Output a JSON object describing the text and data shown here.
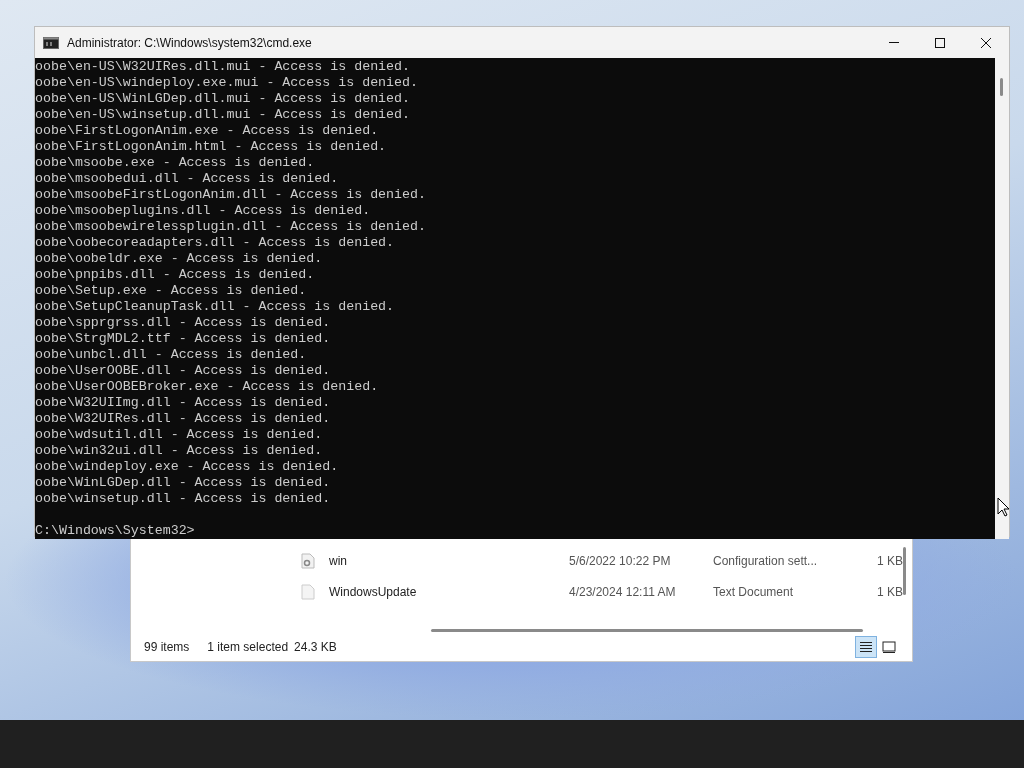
{
  "terminal": {
    "title": "Administrator: C:\\Windows\\system32\\cmd.exe",
    "lines": [
      "oobe\\en-US\\W32UIRes.dll.mui - Access is denied.",
      "oobe\\en-US\\windeploy.exe.mui - Access is denied.",
      "oobe\\en-US\\WinLGDep.dll.mui - Access is denied.",
      "oobe\\en-US\\winsetup.dll.mui - Access is denied.",
      "oobe\\FirstLogonAnim.exe - Access is denied.",
      "oobe\\FirstLogonAnim.html - Access is denied.",
      "oobe\\msoobe.exe - Access is denied.",
      "oobe\\msoobedui.dll - Access is denied.",
      "oobe\\msoobeFirstLogonAnim.dll - Access is denied.",
      "oobe\\msoobeplugins.dll - Access is denied.",
      "oobe\\msoobewirelessplugin.dll - Access is denied.",
      "oobe\\oobecoreadapters.dll - Access is denied.",
      "oobe\\oobeldr.exe - Access is denied.",
      "oobe\\pnpibs.dll - Access is denied.",
      "oobe\\Setup.exe - Access is denied.",
      "oobe\\SetupCleanupTask.dll - Access is denied.",
      "oobe\\spprgrss.dll - Access is denied.",
      "oobe\\StrgMDL2.ttf - Access is denied.",
      "oobe\\unbcl.dll - Access is denied.",
      "oobe\\UserOOBE.dll - Access is denied.",
      "oobe\\UserOOBEBroker.exe - Access is denied.",
      "oobe\\W32UIImg.dll - Access is denied.",
      "oobe\\W32UIRes.dll - Access is denied.",
      "oobe\\wdsutil.dll - Access is denied.",
      "oobe\\win32ui.dll - Access is denied.",
      "oobe\\windeploy.exe - Access is denied.",
      "oobe\\WinLGDep.dll - Access is denied.",
      "oobe\\winsetup.dll - Access is denied."
    ],
    "prompt": "C:\\Windows\\System32>"
  },
  "explorer": {
    "files": [
      {
        "kind": "settings",
        "name": "win",
        "modified": "5/6/2022 10:22 PM",
        "type": "Configuration sett...",
        "size": "1 KB"
      },
      {
        "kind": "text",
        "name": "WindowsUpdate",
        "modified": "4/23/2024 12:11 AM",
        "type": "Text Document",
        "size": "1 KB"
      }
    ],
    "status": {
      "item_count": "99 items",
      "selection": "1 item selected",
      "selection_size": "24.3 KB"
    },
    "views": [
      {
        "kind": "details",
        "selected": true
      },
      {
        "kind": "tiles",
        "selected": false
      }
    ]
  }
}
